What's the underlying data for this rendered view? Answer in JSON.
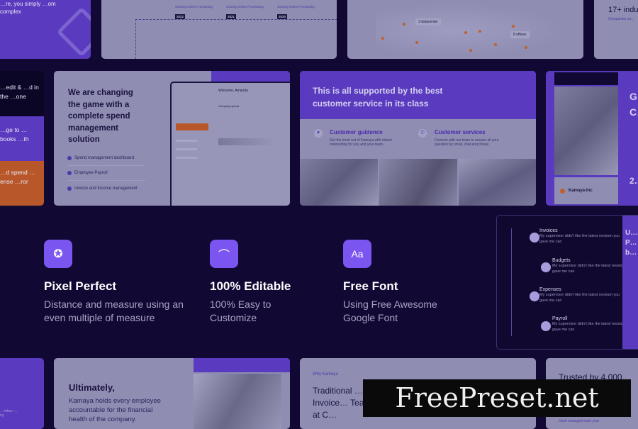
{
  "top_left_card": {
    "text": "…re, you simply …om complex"
  },
  "timeline_card": {
    "items": [
      {
        "label": "Solving Online Purchasing",
        "year": "2022"
      },
      {
        "label": "Solving Online Purchasing",
        "year": "2021"
      },
      {
        "label": "Solving Online Purchasing",
        "year": "2020"
      }
    ]
  },
  "map_card": {
    "label_datacenter": "3 datacenter",
    "label_offices": "8 offices"
  },
  "industries_card": {
    "title": "17+ indu…",
    "subtitle": "Companies ca…"
  },
  "left_strip": {
    "dark_text": "…edit & …d in the …one",
    "purple_text": "…ge to … books …th",
    "orange_text": "…d spend …ense …ror"
  },
  "spend_card": {
    "title": "We are changing the game with a complete spend management solution",
    "items": [
      "Spend management dashboard",
      "Employee Payroll",
      "Invoice and Income management"
    ],
    "screen_welcome": "Welcome, Amanda",
    "screen_section": "Company spend"
  },
  "service_card": {
    "title": "This is all supported by the best customer service in its class",
    "cols": [
      {
        "title": "Customer guidence",
        "desc": "Get the most out of Kamaya with robust onboarding for you and your team."
      },
      {
        "title": "Customer services",
        "desc": "Connect with our team to answer all your question by email, chat and phone."
      }
    ]
  },
  "kamaya_card": {
    "brand": "Kamaya-Inc",
    "title": "G… C…",
    "number": "2…"
  },
  "features": [
    {
      "icon": "award-icon",
      "title": "Pixel Perfect",
      "desc": "Distance and measure using an even multiple of measure"
    },
    {
      "icon": "vector-pen-icon",
      "title": "100% Editable",
      "desc": "100% Easy to Customize"
    },
    {
      "icon": "font-icon",
      "title": "Free Font",
      "desc": "Using Free Awesome Google Font"
    }
  ],
  "timeline_right": {
    "items": [
      {
        "title": "Invoices",
        "desc": "My supervisor didn't like the latest revision you gave me can"
      },
      {
        "title": "Budgets",
        "desc": "My supervisor didn't like the latest revision you gave me can"
      },
      {
        "title": "Expenses",
        "desc": "My supervisor didn't like the latest revision you gave me can"
      },
      {
        "title": "Payroll",
        "desc": "My supervisor didn't like the latest revision you gave me can"
      }
    ],
    "side_text": "U… P… b…"
  },
  "bottom": {
    "left_text": "…mber …ny",
    "ultimately_title": "Ultimately,",
    "ultimately_desc": "Kamaya holds every employee accountable for the financial health of the company.",
    "why_label": "Why Kamaya",
    "why_title": "Traditional … and Invoice… Teams at C…",
    "trusted_title": "Trusted by 4,000…",
    "trusted_sub": "Cash managed each year"
  },
  "watermark": "FreePreset.net",
  "colors": {
    "background": "#120834",
    "purple": "#5a3bbf",
    "accent": "#7b55f0",
    "orange": "#b8582a"
  }
}
